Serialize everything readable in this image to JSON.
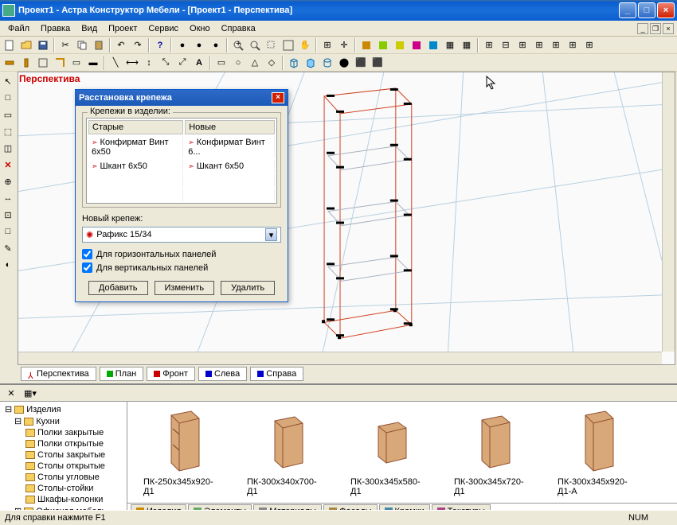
{
  "title": "Проект1 - Астра Конструктор Мебели - [Проект1 - Перспектива]",
  "menu": {
    "file": "Файл",
    "edit": "Правка",
    "view": "Вид",
    "project": "Проект",
    "service": "Сервис",
    "window": "Окно",
    "help": "Справка"
  },
  "view_label": "Перспектива",
  "viewtabs": {
    "perspective": "Перспектива",
    "plan": "План",
    "front": "Фронт",
    "left": "Слева",
    "right": "Справа"
  },
  "dialog": {
    "title": "Расстановка крепежа",
    "group_label": "Крепежи в изделии:",
    "col_old": "Старые",
    "col_new": "Новые",
    "rows": [
      {
        "old": "Конфирмат Винт 6x50",
        "new": "Конфирмат Винт 6..."
      },
      {
        "old": "Шкант 6x50",
        "new": "Шкант 6x50"
      }
    ],
    "new_label": "Новый крепеж:",
    "combo_value": "Рафикс 15/34",
    "chk_horizontal": "Для горизонтальных панелей",
    "chk_vertical": "Для вертикальных панелей",
    "btn_add": "Добавить",
    "btn_change": "Изменить",
    "btn_delete": "Удалить"
  },
  "tree": {
    "root": "Изделия",
    "kitchens": "Кухни",
    "items": [
      "Полки закрытые",
      "Полки открытые",
      "Столы закрытые",
      "Столы открытые",
      "Столы угловые",
      "Столы-стойки",
      "Шкафы-колонки"
    ],
    "office": "Офисная мебель"
  },
  "thumbs": [
    "ПК-250x345x920-Д1",
    "ПК-300x340x700-Д1",
    "ПК-300x345x580-Д1",
    "ПК-300x345x720-Д1",
    "ПК-300x345x920-Д1-А"
  ],
  "libtabs": {
    "items": "Изделия",
    "elements": "Элементы",
    "materials": "Материалы",
    "facades": "Фасады",
    "edges": "Кромки",
    "textures": "Текстуры"
  },
  "status": {
    "hint": "Для справки нажмите F1",
    "num": "NUM"
  }
}
